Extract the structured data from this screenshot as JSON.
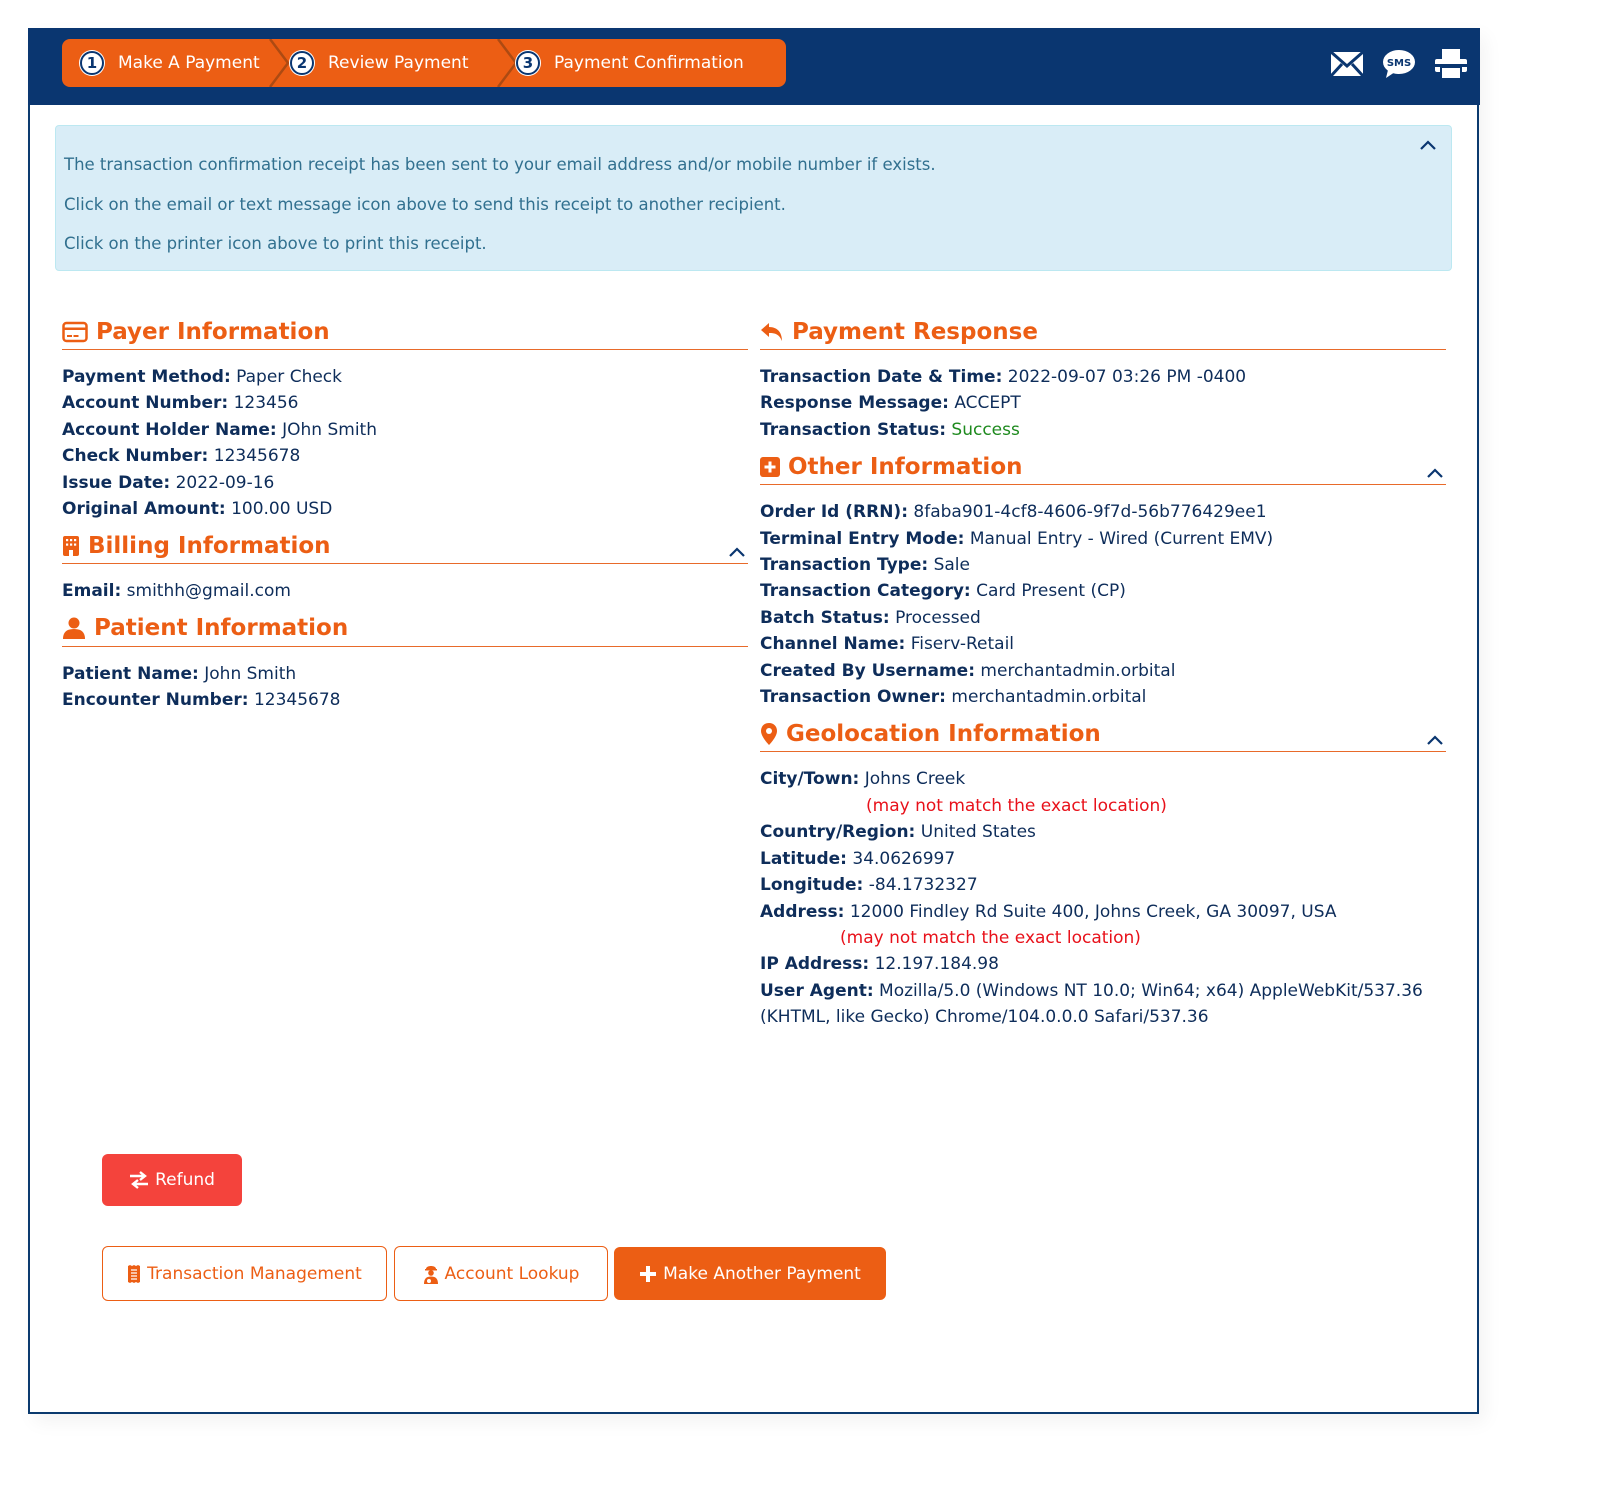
{
  "wizard": {
    "steps": [
      {
        "number": "1",
        "label": "Make A Payment"
      },
      {
        "number": "2",
        "label": "Review Payment"
      },
      {
        "number": "3",
        "label": "Payment Confirmation"
      }
    ]
  },
  "header_icons": [
    "email-icon",
    "sms-icon",
    "printer-icon"
  ],
  "sms_icon_text": "SMS",
  "alert": {
    "lines": [
      "The transaction confirmation receipt has been sent to your email address and/or mobile number if exists.",
      "Click on the email or text message icon above to send this receipt to another recipient.",
      "Click on the printer icon above to print this receipt."
    ]
  },
  "payer": {
    "title": "Payer Information",
    "rows": [
      {
        "label": "Payment Method:",
        "value": "Paper Check"
      },
      {
        "label": "Account Number:",
        "value": "123456"
      },
      {
        "label": "Account Holder Name:",
        "value": "JOhn Smith"
      },
      {
        "label": "Check Number:",
        "value": "12345678"
      },
      {
        "label": "Issue Date:",
        "value": "2022-09-16"
      },
      {
        "label": "Original Amount:",
        "value": "100.00 USD"
      }
    ]
  },
  "billing": {
    "title": "Billing Information",
    "rows": [
      {
        "label": "Email:",
        "value": "smithh@gmail.com"
      }
    ]
  },
  "patient": {
    "title": "Patient Information",
    "rows": [
      {
        "label": "Patient Name:",
        "value": "John Smith"
      },
      {
        "label": "Encounter Number:",
        "value": "12345678"
      }
    ]
  },
  "response": {
    "title": "Payment Response",
    "rows": [
      {
        "label": "Transaction Date & Time:",
        "value": "2022-09-07 03:26 PM -0400"
      },
      {
        "label": "Response Message:",
        "value": "ACCEPT"
      },
      {
        "label": "Transaction Status:",
        "value": "Success"
      }
    ],
    "status_color": "#1e8a1e"
  },
  "other": {
    "title": "Other Information",
    "rows": [
      {
        "label": "Order Id (RRN):",
        "value": "8faba901-4cf8-4606-9f7d-56b776429ee1"
      },
      {
        "label": "Terminal Entry Mode:",
        "value": "Manual Entry - Wired (Current EMV)"
      },
      {
        "label": "Transaction Type:",
        "value": "Sale"
      },
      {
        "label": "Transaction Category:",
        "value": "Card Present (CP)"
      },
      {
        "label": "Batch Status:",
        "value": "Processed"
      },
      {
        "label": "Channel Name:",
        "value": "Fiserv-Retail"
      },
      {
        "label": "Created By Username:",
        "value": "merchantadmin.orbital"
      },
      {
        "label": "Transaction Owner:",
        "value": "merchantadmin.orbital"
      }
    ]
  },
  "geo": {
    "title": "Geolocation Information",
    "city_label": "City/Town:",
    "city_value": "Johns Creek",
    "disclaimer": "(may not match the exact location)",
    "country_label": "Country/Region:",
    "country_value": "United States",
    "lat_label": "Latitude:",
    "lat_value": "34.0626997",
    "lon_label": "Longitude:",
    "lon_value": "-84.1732327",
    "address_label": "Address:",
    "address_value": "12000 Findley Rd Suite 400, Johns Creek, GA 30097, USA",
    "ip_label": "IP Address:",
    "ip_value": "12.197.184.98",
    "ua_label": "User Agent:",
    "ua_value_line1": "Mozilla/5.0 (Windows NT 10.0; Win64; x64) AppleWebKit/537.36",
    "ua_value_line2": "(KHTML, like Gecko) Chrome/104.0.0.0 Safari/537.36"
  },
  "buttons": {
    "refund": "Refund",
    "transaction_management": "Transaction Management",
    "account_lookup": "Account Lookup",
    "make_another_payment": "Make Another Payment"
  },
  "colors": {
    "brand_navy": "#0a3670",
    "accent_orange": "#ec5e14",
    "refund_red": "#f4433c",
    "alert_bg": "#d9edf7",
    "alert_text": "#31708f",
    "warning_red": "#e8111a"
  }
}
